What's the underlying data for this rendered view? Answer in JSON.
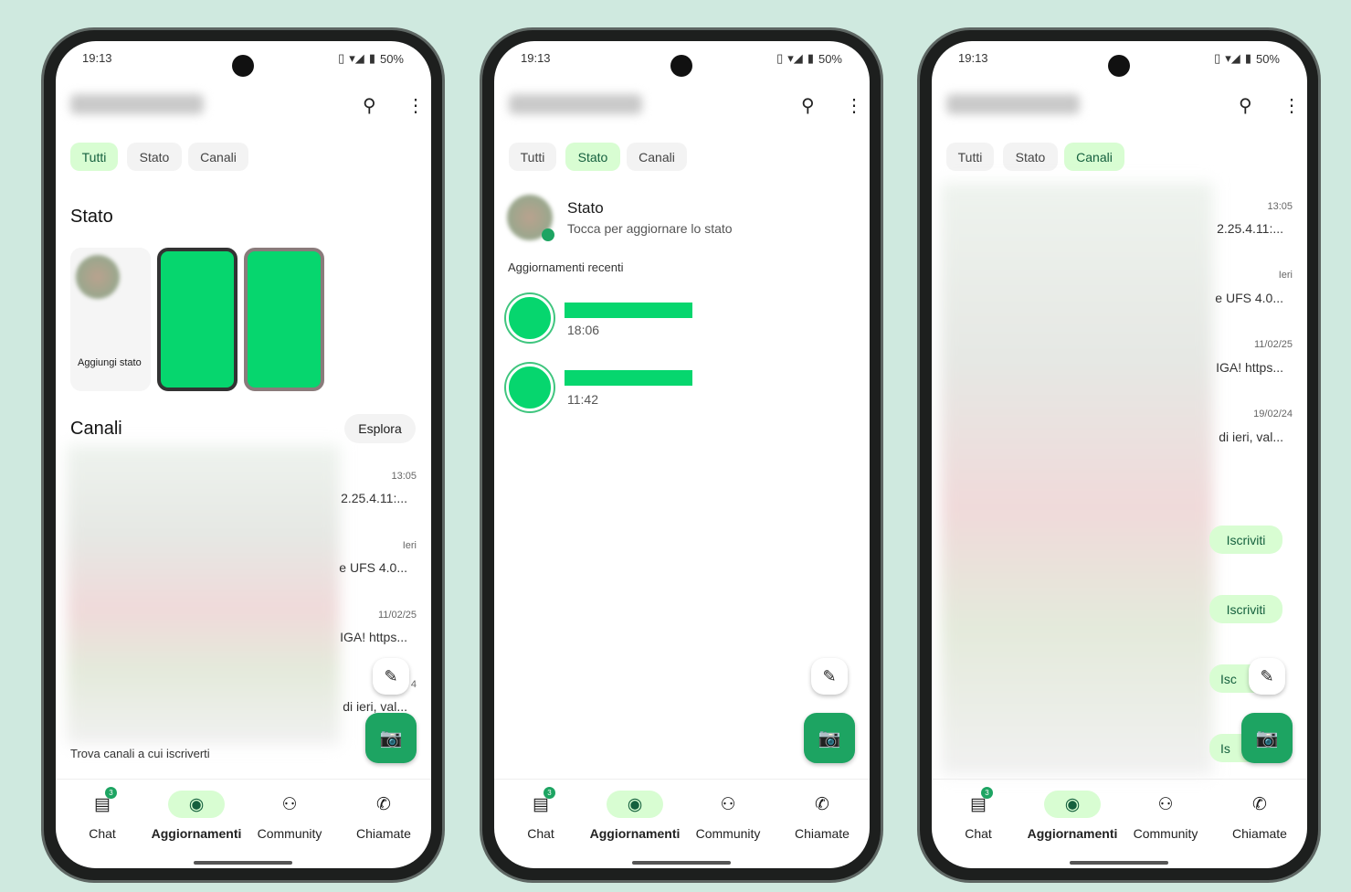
{
  "status_bar": {
    "time": "19:13",
    "battery": "50%"
  },
  "app": {
    "title": "Aggiornamenti"
  },
  "chips": [
    "Tutti",
    "Stato",
    "Canali"
  ],
  "nav": {
    "items": [
      "Chat",
      "Aggiornamenti",
      "Community",
      "Chiamate"
    ],
    "chat_badge": "3"
  },
  "phone1": {
    "stato_heading": "Stato",
    "add_status": "Aggiungi stato",
    "canali_heading": "Canali",
    "explore": "Esplora",
    "channels": [
      {
        "time": "13:05",
        "preview": "2.25.4.11:..."
      },
      {
        "time": "Ieri",
        "preview": "e UFS 4.0..."
      },
      {
        "time": "11/02/25",
        "preview": "IGA! https..."
      },
      {
        "time": "4",
        "preview": "di ieri, val..."
      }
    ],
    "find_channels": "Trova canali a cui iscriverti"
  },
  "phone2": {
    "my_status": "Stato",
    "my_status_sub": "Tocca per aggiornare lo stato",
    "recent": "Aggiornamenti recenti",
    "updates": [
      {
        "time": "18:06"
      },
      {
        "time": "11:42"
      }
    ]
  },
  "phone3": {
    "channels": [
      {
        "time": "13:05",
        "preview": "2.25.4.11:..."
      },
      {
        "time": "Ieri",
        "preview": "e UFS 4.0..."
      },
      {
        "time": "11/02/25",
        "preview": "IGA! https..."
      },
      {
        "time": "19/02/24",
        "preview": "di ieri, val..."
      }
    ],
    "subscribe": [
      "Iscriviti",
      "Iscriviti",
      "Isc",
      "Is"
    ]
  },
  "colors": {
    "accent": "#1da462",
    "chip_active": "#d8fdd2",
    "status_green": "#06d66e"
  }
}
